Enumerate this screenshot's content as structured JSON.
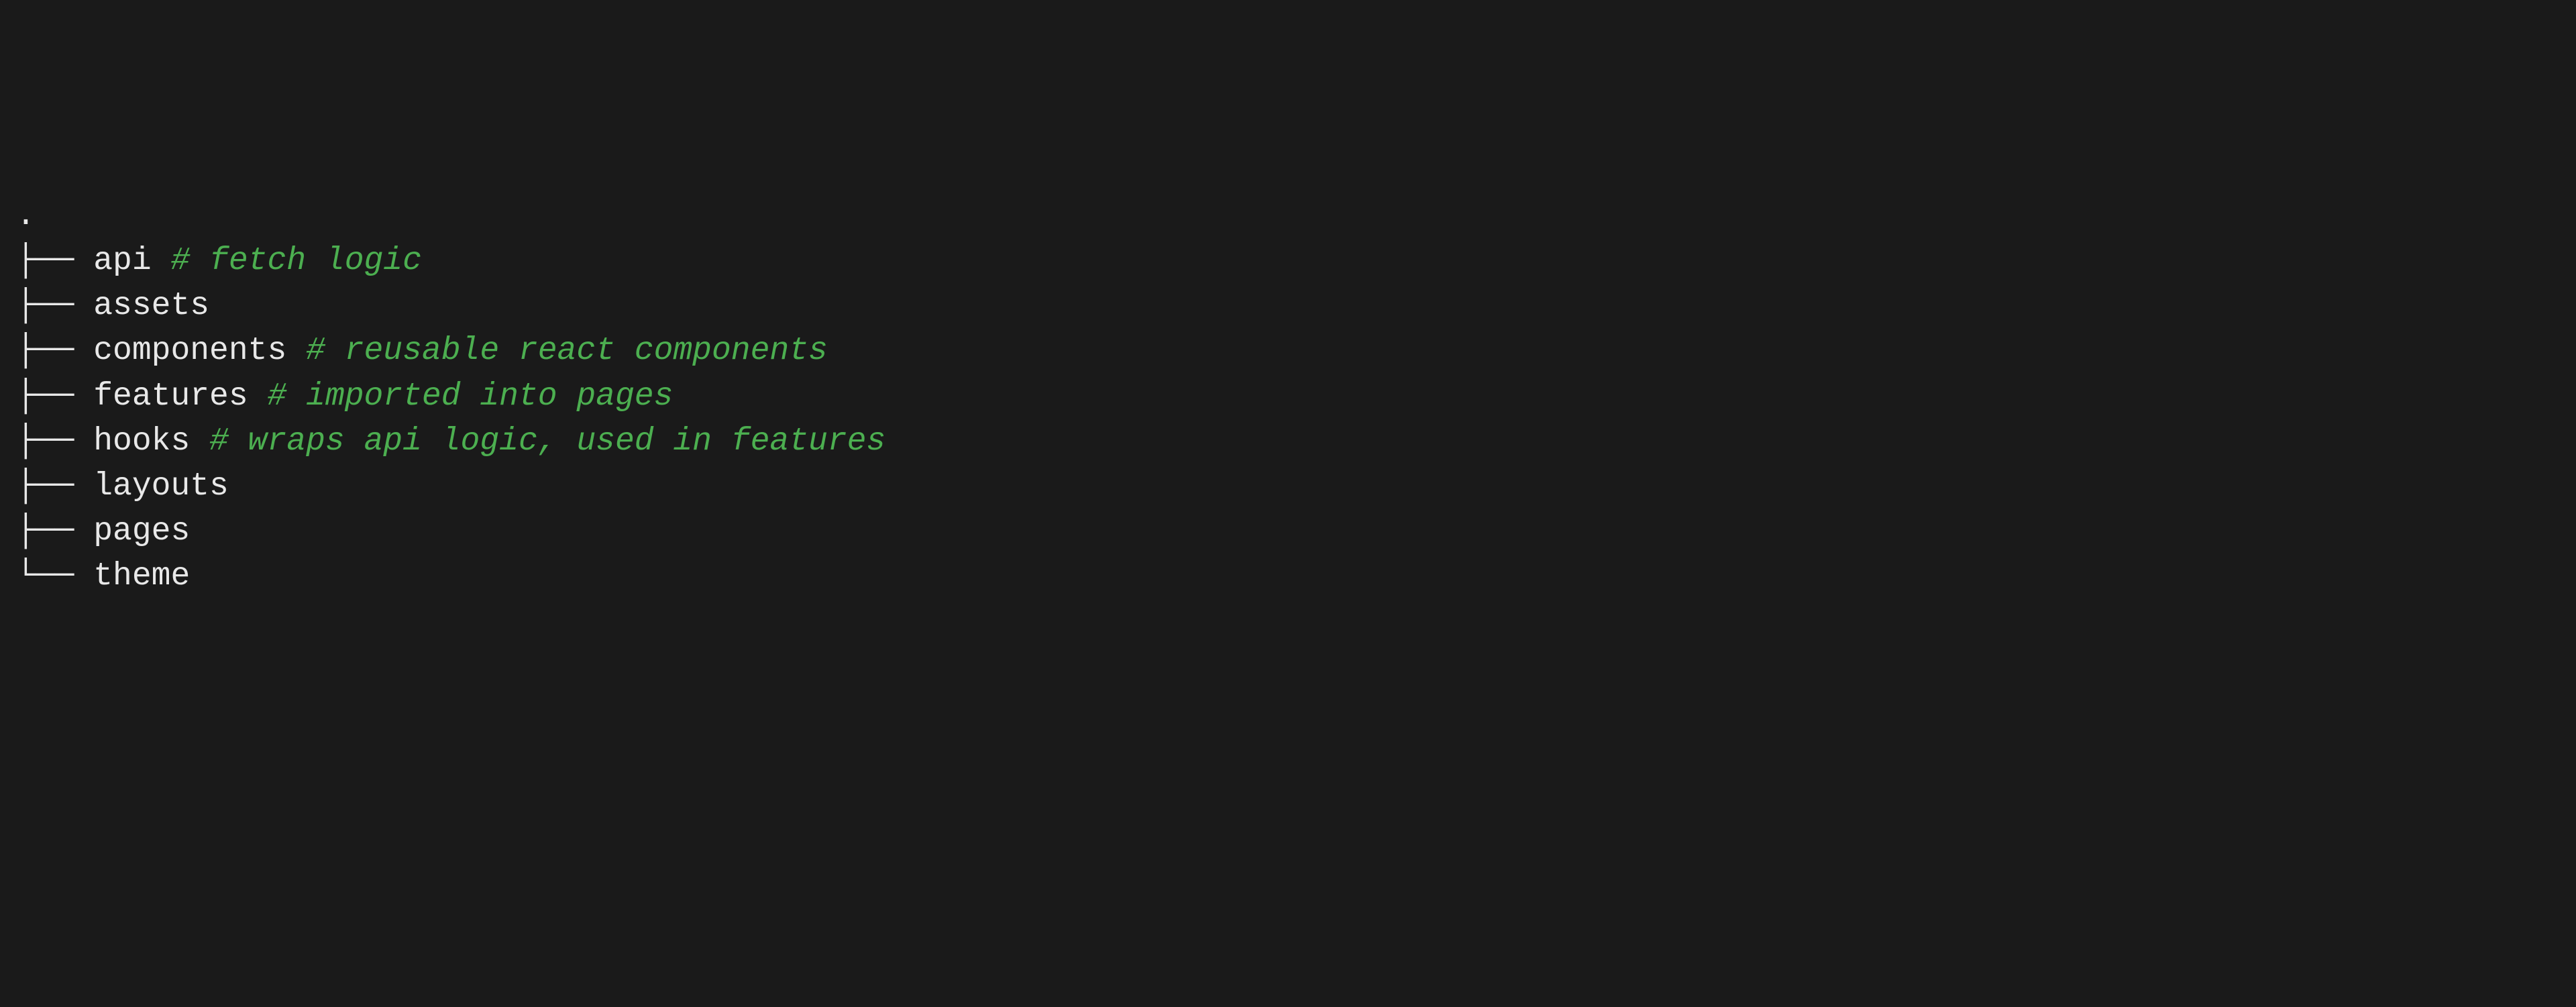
{
  "tree": {
    "root": ".",
    "entries": [
      {
        "connector": "├── ",
        "name": "api",
        "comment": "# fetch logic"
      },
      {
        "connector": "├── ",
        "name": "assets",
        "comment": ""
      },
      {
        "connector": "├── ",
        "name": "components",
        "comment": "# reusable react components"
      },
      {
        "connector": "├── ",
        "name": "features",
        "comment": "# imported into pages"
      },
      {
        "connector": "├── ",
        "name": "hooks",
        "comment": "# wraps api logic, used in features"
      },
      {
        "connector": "├── ",
        "name": "layouts",
        "comment": ""
      },
      {
        "connector": "├── ",
        "name": "pages",
        "comment": ""
      },
      {
        "connector": "└── ",
        "name": "theme",
        "comment": ""
      }
    ]
  }
}
